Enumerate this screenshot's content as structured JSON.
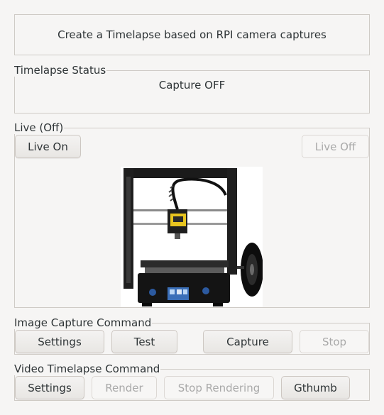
{
  "header": {
    "title": "Create a Timelapse based on RPI camera captures"
  },
  "status": {
    "legend": "Timelapse Status",
    "text": "Capture OFF"
  },
  "live": {
    "legend": "Live (Off)",
    "live_on_label": "Live On",
    "live_off_label": "Live Off",
    "preview_icon": "3d-printer-photo"
  },
  "capture": {
    "legend": "Image Capture Command",
    "settings_label": "Settings",
    "test_label": "Test",
    "capture_label": "Capture",
    "stop_label": "Stop"
  },
  "video": {
    "legend": "Video Timelapse Command",
    "settings_label": "Settings",
    "render_label": "Render",
    "stop_rendering_label": "Stop Rendering",
    "gthumb_label": "Gthumb"
  }
}
